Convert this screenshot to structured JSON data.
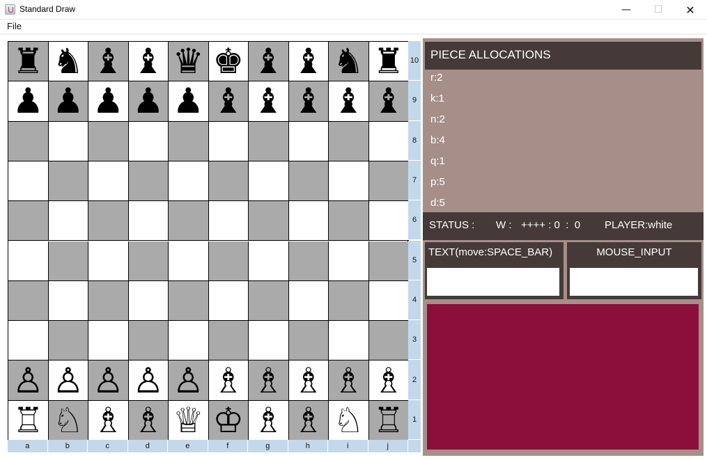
{
  "window": {
    "title": "Standard Draw"
  },
  "menu": {
    "file": "File"
  },
  "board": {
    "files": [
      "a",
      "b",
      "c",
      "d",
      "e",
      "f",
      "g",
      "h",
      "i",
      "j"
    ],
    "ranks": [
      "10",
      "9",
      "8",
      "7",
      "6",
      "5",
      "4",
      "3",
      "2",
      "1"
    ],
    "pieces": [
      [
        "♜",
        "♞",
        "♝",
        "♝",
        "♛",
        "♚",
        "♝",
        "♝",
        "♞",
        "♜"
      ],
      [
        "♟",
        "♟",
        "♟",
        "♟",
        "♟",
        "♝",
        "♝",
        "♝",
        "♝",
        "♝"
      ],
      [
        "",
        "",
        "",
        "",
        "",
        "",
        "",
        "",
        "",
        ""
      ],
      [
        "",
        "",
        "",
        "",
        "",
        "",
        "",
        "",
        "",
        ""
      ],
      [
        "",
        "",
        "",
        "",
        "",
        "",
        "",
        "",
        "",
        ""
      ],
      [
        "",
        "",
        "",
        "",
        "",
        "",
        "",
        "",
        "",
        ""
      ],
      [
        "",
        "",
        "",
        "",
        "",
        "",
        "",
        "",
        "",
        ""
      ],
      [
        "",
        "",
        "",
        "",
        "",
        "",
        "",
        "",
        "",
        ""
      ],
      [
        "♙",
        "♙",
        "♙",
        "♙",
        "♙",
        "♗",
        "♗",
        "♗",
        "♗",
        "♗"
      ],
      [
        "♖",
        "♘",
        "♗",
        "♗",
        "♕",
        "♔",
        "♗",
        "♗",
        "♘",
        "♖"
      ]
    ]
  },
  "panel": {
    "allocations_title": "PIECE ALLOCATIONS",
    "allocations": [
      "r:2",
      "k:1",
      "n:2",
      "b:4",
      "q:1",
      "p:5",
      "d:5"
    ],
    "status": {
      "label": "STATUS :",
      "side": "W :",
      "score": "++++ : 0  :  0",
      "player": "PLAYER:white"
    },
    "text_input_label": "TEXT(move:SPACE_BAR)",
    "text_input_value": "",
    "mouse_input_label": "MOUSE_INPUT",
    "mouse_input_value": ""
  },
  "colors": {
    "light_square": "#ffffff",
    "dark_square": "#aaaaaa",
    "coord_strip": "#c4d8ec",
    "panel_bg": "#a68f89",
    "panel_dark": "#453a38",
    "output_area": "#8c0e3a"
  },
  "icons": {
    "app": "java-app-icon",
    "minimize": "minimize-icon",
    "maximize": "maximize-icon",
    "close": "close-icon"
  }
}
